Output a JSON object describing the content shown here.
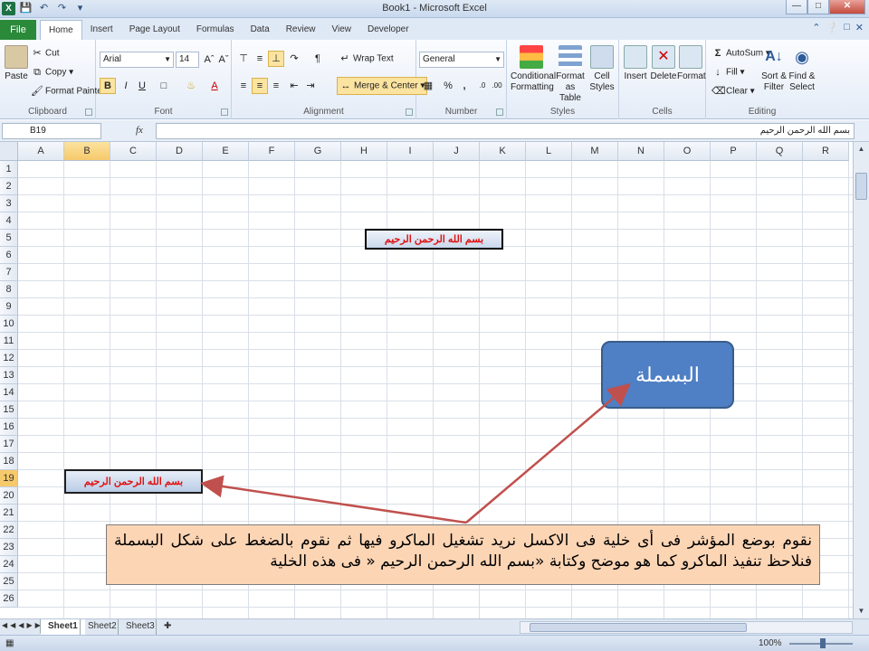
{
  "window": {
    "title": "Book1 - Microsoft Excel"
  },
  "tabs": {
    "file": "File",
    "items": [
      "Home",
      "Insert",
      "Page Layout",
      "Formulas",
      "Data",
      "Review",
      "View",
      "Developer"
    ],
    "active": "Home"
  },
  "ribbon": {
    "clipboard": {
      "label": "Clipboard",
      "paste": "Paste",
      "cut": "Cut",
      "copy": "Copy",
      "format_painter": "Format Painter"
    },
    "font": {
      "label": "Font",
      "name": "Arial",
      "size": "14",
      "bold": "B",
      "italic": "I",
      "underline": "U"
    },
    "alignment": {
      "label": "Alignment",
      "wrap": "Wrap Text",
      "merge": "Merge & Center"
    },
    "number": {
      "label": "Number",
      "format": "General",
      "percent": "%",
      "comma": ","
    },
    "styles": {
      "label": "Styles",
      "conditional": "Conditional",
      "conditional2": "Formatting",
      "format_table": "Format",
      "format_table2": "as Table",
      "cell_styles": "Cell",
      "cell_styles2": "Styles"
    },
    "cells": {
      "label": "Cells",
      "insert": "Insert",
      "delete": "Delete",
      "format": "Format"
    },
    "editing": {
      "label": "Editing",
      "autosum": "AutoSum",
      "fill": "Fill",
      "clear": "Clear",
      "sort": "Sort &",
      "sort2": "Filter",
      "find": "Find &",
      "find2": "Select"
    }
  },
  "formula_bar": {
    "name_box": "B19",
    "fx": "fx",
    "value": "بسم الله الرحمن الرحيم"
  },
  "columns": [
    "A",
    "B",
    "C",
    "D",
    "E",
    "F",
    "G",
    "H",
    "I",
    "J",
    "K",
    "L",
    "M",
    "N",
    "O",
    "P",
    "Q",
    "R"
  ],
  "selected_column": "B",
  "rows": [
    "1",
    "2",
    "3",
    "4",
    "5",
    "6",
    "7",
    "8",
    "9",
    "10",
    "11",
    "12",
    "13",
    "14",
    "15",
    "16",
    "17",
    "18",
    "19",
    "20",
    "21",
    "22",
    "23",
    "24",
    "25",
    "26"
  ],
  "selected_row": "19",
  "cells": {
    "i5": "بسم الله الرحمن الرحيم",
    "b19": "بسم الله الرحمن الرحيم"
  },
  "callouts": {
    "macro_name": "البسملة",
    "explanation": "نقوم بوضع المؤشر فى أى خلية فى الاكسل نريد تشغيل الماكرو فيها ثم نقوم بالضغط على شكل البسملة فنلاحظ تنفيذ الماكرو كما هو موضح وكتابة «بسم الله الرحمن الرحيم « فى هذه الخلية"
  },
  "sheets": [
    "Sheet1",
    "Sheet2",
    "Sheet3"
  ],
  "active_sheet": "Sheet1",
  "status": {
    "zoom": "100%"
  },
  "colors": {
    "accent_green": "#2a8a3a",
    "selection": "#f6c96a",
    "callout_blue": "#4f7fc4",
    "callout_peach": "#fcd5b5",
    "arrow_red": "#c0504d",
    "cell_text_red": "#e01010"
  }
}
